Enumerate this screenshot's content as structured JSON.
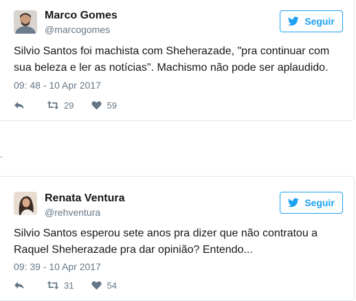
{
  "follow_label": "Seguir",
  "colors": {
    "twitter_blue": "#1da1f2",
    "secondary_text": "#657786",
    "border": "#e1e8ed"
  },
  "tweets": [
    {
      "name": "Marco Gomes",
      "handle": "@marcogomes",
      "text": "Silvio Santos foi machista com Sheherazade, \"pra continuar com sua beleza e ler as notícias\". Machismo não pode ser aplaudido.",
      "timestamp": "09: 48 - 10 Apr 2017",
      "retweets": "29",
      "likes": "59"
    },
    {
      "name": "Renata Ventura",
      "handle": "@rehventura",
      "text": "Silvio Santos esperou sete anos pra dizer que não contratou a Raquel Sheherazade pra dar opinião? Entendo...",
      "timestamp": "09: 39 - 10 Apr 2017",
      "retweets": "31",
      "likes": "54"
    }
  ]
}
